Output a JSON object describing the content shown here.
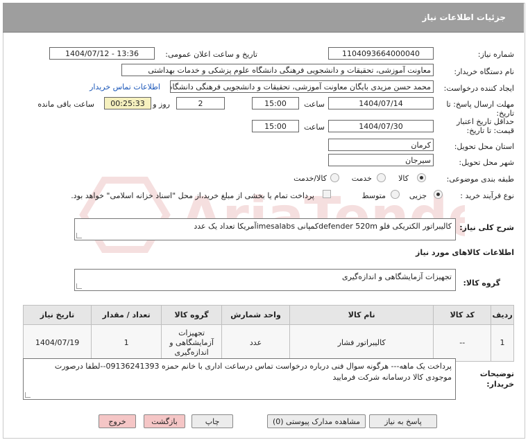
{
  "header": {
    "title": "جزئیات اطلاعات نیاز"
  },
  "watermark": {
    "text": "AriaTender.net"
  },
  "fields": {
    "need_number_label": "شماره نیاز:",
    "need_number": "1104093664000040",
    "announce_label": "تاریخ و ساعت اعلان عمومی:",
    "announce_value": "1404/07/12 - 13:36",
    "buyer_org_label": "نام دستگاه خریدار:",
    "buyer_org": "معاونت آموزشی، تحقیقات و دانشجویی فرهنگی دانشگاه علوم پزشکی و خدمات بهداشتی",
    "requester_label": "ایجاد کننده درخواست:",
    "requester": "محمد حسن  مزیدی بایگان معاونت آموزشی، تحقیقات و دانشجویی فرهنگی دانشگاه",
    "buyer_contact_link": "اطلاعات تماس خریدار",
    "send_deadline_label_1": "مهلت ارسال پاسخ: تا",
    "send_deadline_label_2": "تاریخ:",
    "send_date": "1404/07/14",
    "time_label": "ساعت",
    "send_time": "15:00",
    "days_value": "2",
    "days_label": "روز و",
    "remaining_time": "00:25:33",
    "remaining_label": "ساعت باقی مانده",
    "price_validity_label_1": "حداقل تاریخ اعتبار",
    "price_validity_label_2": "قیمت: تا تاریخ:",
    "validity_date": "1404/07/30",
    "validity_time_label": "ساعت",
    "validity_time": "15:00",
    "province_label": "استان محل تحویل:",
    "province": "کرمان",
    "city_label": "شهر محل تحویل:",
    "city": "سیرجان",
    "category_label": "طبقه بندی موضوعی:",
    "category_options": [
      "کالا",
      "خدمت",
      "کالا/خدمت"
    ],
    "category_selected": "کالا",
    "process_label": "نوع فرآیند خرید :",
    "process_options": [
      "جزیی",
      "متوسط"
    ],
    "process_selected": "جزیی",
    "payment_note": "پرداخت تمام یا بخشی از مبلغ خرید،از محل \"اسناد خزانه اسلامی\" خواهد بود."
  },
  "description": {
    "label": "شرح کلی نیاز:",
    "text": "کالیبراتور الکتریکی فلو  defender 520mکمپانی imesalabsآمریکا تعداد یک عدد"
  },
  "goods_info": {
    "title": "اطلاعات کالاهای مورد نیاز",
    "group_label": "گروه کالا:",
    "group_value": "تجهیزات آزمایشگاهی و اندازه‌گیری"
  },
  "table": {
    "headers": [
      "ردیف",
      "کد کالا",
      "نام کالا",
      "واحد شمارش",
      "تعداد / مقدار",
      "تاریخ نیاز"
    ],
    "extra_header": "نام کالا",
    "col_group_header": "گروه کالا",
    "rows": [
      {
        "row": "1",
        "code": "--",
        "name": "کالیبراتور فشار",
        "unit": "عدد",
        "group": "تجهیزات آزمایشگاهی و اندازه‌گیری",
        "qty": "1",
        "date": "1404/07/19"
      }
    ]
  },
  "buyer_notes": {
    "label_1": "توضیحات",
    "label_2": "خریدار:",
    "text": "پرداخت یک ماهه--- هرگونه سوال فنی درباره درخواست تماس درساعت اداری با خانم حمزه 09136241393--لطفا درصورت موجودی کالا درسامانه شرکت فرمایید"
  },
  "buttons": {
    "reply": "پاسخ به نیاز",
    "attachments": "مشاهده مدارک پیوستی (0)",
    "print": "چاپ",
    "back": "بازگشت",
    "exit": "خروج"
  }
}
